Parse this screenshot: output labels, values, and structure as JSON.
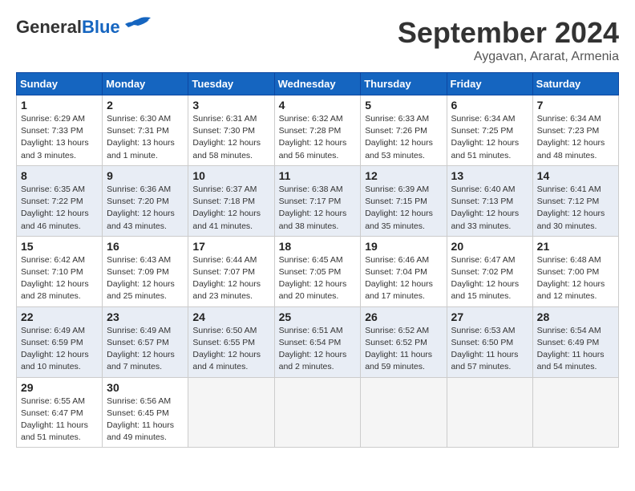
{
  "header": {
    "logo_line1": "General",
    "logo_line2": "Blue",
    "month_title": "September 2024",
    "location": "Aygavan, Ararat, Armenia"
  },
  "days_of_week": [
    "Sunday",
    "Monday",
    "Tuesday",
    "Wednesday",
    "Thursday",
    "Friday",
    "Saturday"
  ],
  "weeks": [
    [
      {
        "day": "1",
        "info": "Sunrise: 6:29 AM\nSunset: 7:33 PM\nDaylight: 13 hours\nand 3 minutes."
      },
      {
        "day": "2",
        "info": "Sunrise: 6:30 AM\nSunset: 7:31 PM\nDaylight: 13 hours\nand 1 minute."
      },
      {
        "day": "3",
        "info": "Sunrise: 6:31 AM\nSunset: 7:30 PM\nDaylight: 12 hours\nand 58 minutes."
      },
      {
        "day": "4",
        "info": "Sunrise: 6:32 AM\nSunset: 7:28 PM\nDaylight: 12 hours\nand 56 minutes."
      },
      {
        "day": "5",
        "info": "Sunrise: 6:33 AM\nSunset: 7:26 PM\nDaylight: 12 hours\nand 53 minutes."
      },
      {
        "day": "6",
        "info": "Sunrise: 6:34 AM\nSunset: 7:25 PM\nDaylight: 12 hours\nand 51 minutes."
      },
      {
        "day": "7",
        "info": "Sunrise: 6:34 AM\nSunset: 7:23 PM\nDaylight: 12 hours\nand 48 minutes."
      }
    ],
    [
      {
        "day": "8",
        "info": "Sunrise: 6:35 AM\nSunset: 7:22 PM\nDaylight: 12 hours\nand 46 minutes."
      },
      {
        "day": "9",
        "info": "Sunrise: 6:36 AM\nSunset: 7:20 PM\nDaylight: 12 hours\nand 43 minutes."
      },
      {
        "day": "10",
        "info": "Sunrise: 6:37 AM\nSunset: 7:18 PM\nDaylight: 12 hours\nand 41 minutes."
      },
      {
        "day": "11",
        "info": "Sunrise: 6:38 AM\nSunset: 7:17 PM\nDaylight: 12 hours\nand 38 minutes."
      },
      {
        "day": "12",
        "info": "Sunrise: 6:39 AM\nSunset: 7:15 PM\nDaylight: 12 hours\nand 35 minutes."
      },
      {
        "day": "13",
        "info": "Sunrise: 6:40 AM\nSunset: 7:13 PM\nDaylight: 12 hours\nand 33 minutes."
      },
      {
        "day": "14",
        "info": "Sunrise: 6:41 AM\nSunset: 7:12 PM\nDaylight: 12 hours\nand 30 minutes."
      }
    ],
    [
      {
        "day": "15",
        "info": "Sunrise: 6:42 AM\nSunset: 7:10 PM\nDaylight: 12 hours\nand 28 minutes."
      },
      {
        "day": "16",
        "info": "Sunrise: 6:43 AM\nSunset: 7:09 PM\nDaylight: 12 hours\nand 25 minutes."
      },
      {
        "day": "17",
        "info": "Sunrise: 6:44 AM\nSunset: 7:07 PM\nDaylight: 12 hours\nand 23 minutes."
      },
      {
        "day": "18",
        "info": "Sunrise: 6:45 AM\nSunset: 7:05 PM\nDaylight: 12 hours\nand 20 minutes."
      },
      {
        "day": "19",
        "info": "Sunrise: 6:46 AM\nSunset: 7:04 PM\nDaylight: 12 hours\nand 17 minutes."
      },
      {
        "day": "20",
        "info": "Sunrise: 6:47 AM\nSunset: 7:02 PM\nDaylight: 12 hours\nand 15 minutes."
      },
      {
        "day": "21",
        "info": "Sunrise: 6:48 AM\nSunset: 7:00 PM\nDaylight: 12 hours\nand 12 minutes."
      }
    ],
    [
      {
        "day": "22",
        "info": "Sunrise: 6:49 AM\nSunset: 6:59 PM\nDaylight: 12 hours\nand 10 minutes."
      },
      {
        "day": "23",
        "info": "Sunrise: 6:49 AM\nSunset: 6:57 PM\nDaylight: 12 hours\nand 7 minutes."
      },
      {
        "day": "24",
        "info": "Sunrise: 6:50 AM\nSunset: 6:55 PM\nDaylight: 12 hours\nand 4 minutes."
      },
      {
        "day": "25",
        "info": "Sunrise: 6:51 AM\nSunset: 6:54 PM\nDaylight: 12 hours\nand 2 minutes."
      },
      {
        "day": "26",
        "info": "Sunrise: 6:52 AM\nSunset: 6:52 PM\nDaylight: 11 hours\nand 59 minutes."
      },
      {
        "day": "27",
        "info": "Sunrise: 6:53 AM\nSunset: 6:50 PM\nDaylight: 11 hours\nand 57 minutes."
      },
      {
        "day": "28",
        "info": "Sunrise: 6:54 AM\nSunset: 6:49 PM\nDaylight: 11 hours\nand 54 minutes."
      }
    ],
    [
      {
        "day": "29",
        "info": "Sunrise: 6:55 AM\nSunset: 6:47 PM\nDaylight: 11 hours\nand 51 minutes."
      },
      {
        "day": "30",
        "info": "Sunrise: 6:56 AM\nSunset: 6:45 PM\nDaylight: 11 hours\nand 49 minutes."
      },
      null,
      null,
      null,
      null,
      null
    ]
  ]
}
